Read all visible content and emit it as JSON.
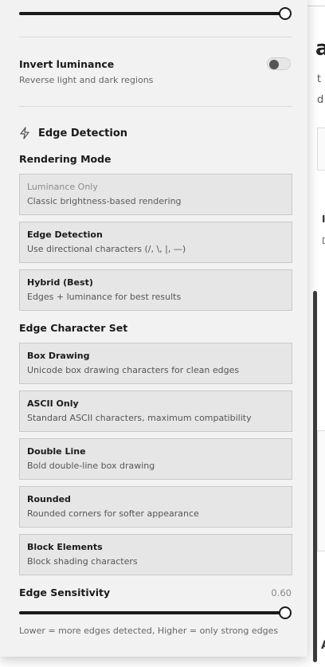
{
  "background": {
    "big_glyph": "a",
    "line1": "t",
    "line2": "d",
    "line3": "I",
    "line4": "D",
    "line5": "A"
  },
  "invert": {
    "title": "Invert luminance",
    "description": "Reverse light and dark regions",
    "enabled": false
  },
  "edge_detection": {
    "header": "Edge Detection",
    "header_icon": "lightning-icon",
    "rendering_mode": {
      "label": "Rendering Mode",
      "options": [
        {
          "title": "Luminance Only",
          "description": "Classic brightness-based rendering",
          "disabled": true
        },
        {
          "title": "Edge Detection",
          "description": "Use directional characters (/, \\, |, —)",
          "disabled": false
        },
        {
          "title": "Hybrid (Best)",
          "description": "Edges + luminance for best results",
          "disabled": false
        }
      ]
    },
    "character_set": {
      "label": "Edge Character Set",
      "options": [
        {
          "title": "Box Drawing",
          "description": "Unicode box drawing characters for clean edges"
        },
        {
          "title": "ASCII Only",
          "description": "Standard ASCII characters, maximum compatibility"
        },
        {
          "title": "Double Line",
          "description": "Bold double-line box drawing"
        },
        {
          "title": "Rounded",
          "description": "Rounded corners for softer appearance"
        },
        {
          "title": "Block Elements",
          "description": "Block shading characters"
        }
      ]
    },
    "sensitivity": {
      "label": "Edge Sensitivity",
      "value": "0.60",
      "hint": "Lower = more edges detected, Higher = only strong edges"
    }
  }
}
